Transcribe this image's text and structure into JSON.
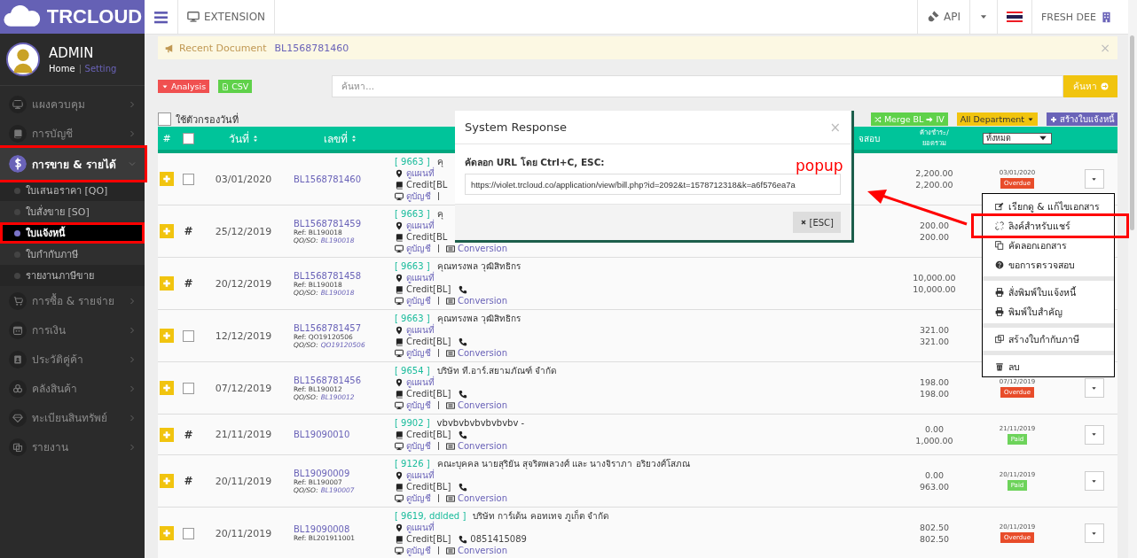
{
  "brand": {
    "name": "TRCLOUD"
  },
  "user": {
    "name": "ADMIN",
    "links": [
      {
        "label": "Home",
        "selected": true
      },
      {
        "label": "Setting",
        "selected": false
      }
    ]
  },
  "sidebar": {
    "items": [
      {
        "label": "แผงควบคุม",
        "expanded": false,
        "selected": false,
        "highlighted": false
      },
      {
        "label": "การบัญชี",
        "expanded": false,
        "selected": false,
        "highlighted": false
      },
      {
        "label": "การขาย & รายได้",
        "expanded": true,
        "selected": true,
        "highlighted": true,
        "children": [
          {
            "label": "ใบเสนอราคา [QO]",
            "selected": false,
            "highlighted": false
          },
          {
            "label": "ใบสั่งขาย [SO]",
            "selected": false,
            "highlighted": false
          },
          {
            "label": "ใบแจ้งหนี้",
            "selected": true,
            "highlighted": true
          },
          {
            "label": "ใบกำกับภาษี",
            "selected": false,
            "highlighted": false
          },
          {
            "label": "รายงานภาษีขาย",
            "selected": false,
            "highlighted": false
          }
        ]
      },
      {
        "label": "การซื้อ & รายจ่าย",
        "expanded": false,
        "selected": false,
        "highlighted": false
      },
      {
        "label": "การเงิน",
        "expanded": false,
        "selected": false,
        "highlighted": false
      },
      {
        "label": "ประวัติคู่ค้า",
        "expanded": false,
        "selected": false,
        "highlighted": false
      },
      {
        "label": "คลังสินค้า",
        "expanded": false,
        "selected": false,
        "highlighted": false
      },
      {
        "label": "ทะเบียนสินทรัพย์",
        "expanded": false,
        "selected": false,
        "highlighted": false
      },
      {
        "label": "รายงาน",
        "expanded": false,
        "selected": false,
        "highlighted": false
      }
    ]
  },
  "topbar": {
    "extension": "EXTENSION",
    "api": "API",
    "company": "FRESH DEE"
  },
  "notice": {
    "label": "Recent Document",
    "link": "BL1568781460",
    "close": "×"
  },
  "toolbar": {
    "analysis": "Analysis",
    "csv": "CSV",
    "search": {
      "placeholder": "ค้นหา..."
    },
    "search_button": "ค้นหา"
  },
  "filter": {
    "label": "ใช้ตัวกรองวันที่",
    "checked": false
  },
  "actions": {
    "merge": "Merge BL",
    "merge_target": "IV",
    "department": "All Department",
    "create": "สร้างใบแจ้งหนี้"
  },
  "table": {
    "header": {
      "hash": "#",
      "all_checked": false,
      "date": "วันที่",
      "number": "เลขที่",
      "column_6": "จสอบ",
      "amount": "ค้างชำระ/ ยอดรวม",
      "status_filter": "ทั้งหมด"
    },
    "rows": [
      {
        "kind": "checkbox",
        "checked": false,
        "date": "03/01/2020",
        "number": "BL1568781460",
        "code": "[ 9663 ]",
        "customer": "คุ",
        "map": "ดูแผนที่",
        "credit": "Credit[BL",
        "account": "ดูบัญชี",
        "balance": "2,200.00",
        "total": "2,200.00",
        "status_date": "03/01/2020",
        "status": {
          "label": "Overdue",
          "color": "#e84c2a"
        },
        "menu_button": true
      },
      {
        "kind": "hash",
        "mark": "#",
        "date": "25/12/2019",
        "number": "BL1568781459",
        "ref": "Ref: BL190018",
        "qoso_label": "QO/SO:",
        "qoso": "BL190018",
        "code": "[ 9663 ]",
        "customer": "คุ",
        "map": "ดูแผนที่",
        "credit": "Credit[BL",
        "account": "ดูบัญชี",
        "conversion": "Conversion",
        "balance": "200.00",
        "total": "200.00"
      },
      {
        "kind": "hash",
        "mark": "#",
        "date": "20/12/2019",
        "number": "BL1568781458",
        "ref": "Ref: BL190018",
        "qoso_label": "QO/SO:",
        "qoso": "BL190018",
        "code": "[ 9663 ]",
        "customer": "คุณทรงพล วุฒิสิทธิกร",
        "map": "ดูแผนที่",
        "credit": "Credit[BL]",
        "phone": "",
        "account": "ดูบัญชี",
        "conversion": "Conversion",
        "balance": "10,000.00",
        "total": "10,000.00"
      },
      {
        "kind": "checkbox",
        "checked": false,
        "date": "12/12/2019",
        "number": "BL1568781457",
        "ref": "Ref: QO19120506",
        "qoso_label": "QO/SO:",
        "qoso": "QO19120506",
        "code": "[ 9663 ]",
        "customer": "คุณทรงพล วุฒิสิทธิกร",
        "map": "ดูแผนที่",
        "credit": "Credit[BL]",
        "phone": "",
        "account": "ดูบัญชี",
        "conversion": "Conversion",
        "balance": "321.00",
        "total": "321.00"
      },
      {
        "kind": "checkbox",
        "checked": false,
        "date": "07/12/2019",
        "number": "BL1568781456",
        "ref": "Ref: BL190012",
        "qoso_label": "QO/SO:",
        "qoso": "BL190012",
        "code": "[ 9654 ]",
        "customer": "บริษัท ที.อาร์.สยามภัณฑ์ จำกัด",
        "map": "ดูแผนที่",
        "credit": "Credit[BL]",
        "phone": "",
        "account": "ดูบัญชี",
        "conversion": "Conversion",
        "balance": "198.00",
        "total": "198.00",
        "status_date": "07/12/2019",
        "status": {
          "label": "Overdue",
          "color": "#e84c2a"
        },
        "menu_button": true
      },
      {
        "kind": "hash",
        "mark": "#",
        "date": "21/11/2019",
        "number": "BL19090010",
        "code": "[ 9902 ]",
        "customer": "vbvbvbvbvbvbvbv -",
        "credit": "Credit[BL]",
        "phone": "",
        "account": "ดูบัญชี",
        "conversion": "Conversion",
        "balance": "0.00",
        "total": "1,000.00",
        "status_date": "21/11/2019",
        "status": {
          "label": "Paid",
          "color": "#6dd35a"
        },
        "menu_button": true
      },
      {
        "kind": "hash",
        "mark": "#",
        "date": "20/11/2019",
        "number": "BL19090009",
        "ref": "Ref: BL190007",
        "qoso_label": "QO/SO:",
        "qoso": "BL190007",
        "code": "[ 9126 ]",
        "customer": "คณะบุคคล นายสุริยัน สุจริตพลวงศ์ และ นางจิราภา อริยวงศ์โสภณ",
        "map": "ดูแผนที่",
        "credit": "Credit[BL]",
        "phone": "",
        "account": "ดูบัญชี",
        "conversion": "Conversion",
        "balance": "0.00",
        "total": "963.00",
        "status_date": "20/11/2019",
        "status": {
          "label": "Paid",
          "color": "#6dd35a"
        },
        "menu_button": true
      },
      {
        "kind": "checkbox",
        "checked": false,
        "date": "20/11/2019",
        "number": "BL19090008",
        "ref": "Ref: BL201911001",
        "code": "[ 9619, ddlded ]",
        "customer": "บริษัท การ์เด้น คอทเทจ ภูเก็ต จำกัด",
        "map": "ดูแผนที่",
        "credit": "Credit[BL]",
        "phone": "0851415089",
        "account": "ดูบัญชี",
        "conversion": "Conversion",
        "balance": "802.50",
        "total": "802.50",
        "status_date": "20/11/2019",
        "status": {
          "label": "Overdue",
          "color": "#e84c2a"
        },
        "menu_button": true
      }
    ]
  },
  "row_menu": {
    "items": [
      {
        "label": "เรียกดู & แก้ไขเอกสาร",
        "kind": "edit",
        "highlighted": false
      },
      {
        "label": "ลิงค์สำหรับแชร์",
        "kind": "link",
        "highlighted": true
      },
      {
        "label": "คัดลอกเอกสาร",
        "kind": "copy",
        "highlighted": false
      },
      {
        "label": "ขอการตรวจสอบ",
        "kind": "question",
        "highlighted": false
      },
      {
        "kind": "separator"
      },
      {
        "label": "สั่งพิมพ์ใบแจ้งหนี้",
        "kind": "print",
        "highlighted": false
      },
      {
        "label": "พิมพ์ใบสำคัญ",
        "kind": "print",
        "highlighted": false
      },
      {
        "kind": "separator"
      },
      {
        "label": "สร้างใบกำกับภาษี",
        "kind": "tax",
        "highlighted": false
      },
      {
        "kind": "separator"
      },
      {
        "label": "ลบ",
        "kind": "trash",
        "highlighted": false
      }
    ]
  },
  "dialog": {
    "title": "System Response",
    "close": "×",
    "label": "คัดลอก URL โดย Ctrl+C, ESC:",
    "url": "https://violet.trcloud.co/application/view/bill.php?id=2092&t=1578712318&k=a6f576ea7a",
    "button": "[ESC]"
  },
  "annotation": {
    "label": "popup"
  }
}
